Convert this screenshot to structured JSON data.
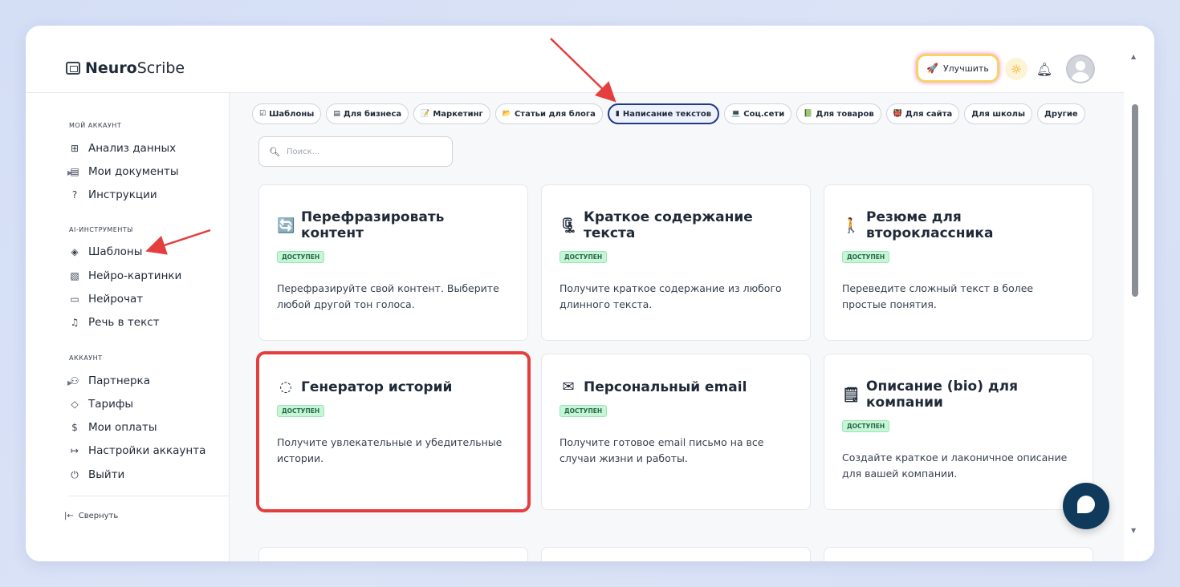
{
  "app": {
    "brand_bold": "Neuro",
    "brand_rest": "Scribe",
    "upgrade_label": "Улучшить"
  },
  "sidebar": {
    "sections": [
      {
        "title": "МОЙ АККАУНТ"
      },
      {
        "title": "AI-ИНСТРУМЕНТЫ"
      },
      {
        "title": "АККАУНТ"
      }
    ],
    "items": [
      {
        "label": "Анализ данных",
        "icon": "grid-icon"
      },
      {
        "label": "Мои документы",
        "icon": "document-icon"
      },
      {
        "label": "Инструкции",
        "icon": "help-circle-icon"
      },
      {
        "label": "Шаблоны",
        "icon": "layers-icon"
      },
      {
        "label": "Нейро-картинки",
        "icon": "image-icon"
      },
      {
        "label": "Нейрочат",
        "icon": "chat-icon"
      },
      {
        "label": "Речь в текст",
        "icon": "headphones-icon"
      },
      {
        "label": "Партнерка",
        "icon": "users-icon"
      },
      {
        "label": "Тарифы",
        "icon": "tag-icon"
      },
      {
        "label": "Мои оплаты",
        "icon": "dollar-icon"
      },
      {
        "label": "Настройки аккаунта",
        "icon": "logout-arrow-icon"
      },
      {
        "label": "Выйти",
        "icon": "power-icon"
      }
    ],
    "collapse_label": "Свернуть"
  },
  "categories": [
    {
      "label": "Шаблоны",
      "icon": "☑",
      "active": false
    },
    {
      "label": "Для бизнеса",
      "icon": "▤",
      "active": false
    },
    {
      "label": "Маркетинг",
      "icon": "📝",
      "active": false
    },
    {
      "label": "Статьи для блога",
      "icon": "📂",
      "active": false
    },
    {
      "label": "Написание текстов",
      "icon": "▮",
      "active": true
    },
    {
      "label": "Соц.сети",
      "icon": "💻",
      "active": false
    },
    {
      "label": "Для товаров",
      "icon": "📗",
      "active": false
    },
    {
      "label": "Для сайта",
      "icon": "👹",
      "active": false
    },
    {
      "label": "Для школы",
      "icon": "",
      "active": false
    },
    {
      "label": "Другие",
      "icon": "",
      "active": false
    }
  ],
  "search": {
    "placeholder": "Поиск..."
  },
  "cards": [
    {
      "title": "Перефразировать контент",
      "icon": "🔄",
      "badge": "ДОСТУПЕН",
      "desc": "Перефразируйте свой контент. Выберите любой другой тон голоса."
    },
    {
      "title": "Краткое содержание текста",
      "icon": "🗜",
      "badge": "ДОСТУПЕН",
      "desc": "Получите краткое содержание из любого длинного текста."
    },
    {
      "title": "Резюме для второклассника",
      "icon": "🚶",
      "badge": "ДОСТУПЕН",
      "desc": "Переведите сложный текст в более простые понятия."
    },
    {
      "title": "Генератор историй",
      "icon": "◌",
      "badge": "ДОСТУПЕН",
      "desc": "Получите увлекательные и убедительные истории."
    },
    {
      "title": "Персональный email",
      "icon": "✉",
      "badge": "ДОСТУПЕН",
      "desc": "Получите готовое email письмо на все случаи жизни и работы."
    },
    {
      "title": "Описание (bio) для компании",
      "icon": "🗒",
      "badge": "ДОСТУПЕН",
      "desc": "Создайте краткое и лаконичное описание для вашей компании."
    }
  ],
  "colors": {
    "accent": "#1e3a8a",
    "badge_bg": "#c6f6d5",
    "highlight": "#e53e3e",
    "chat_fab": "#0f3a5c"
  }
}
